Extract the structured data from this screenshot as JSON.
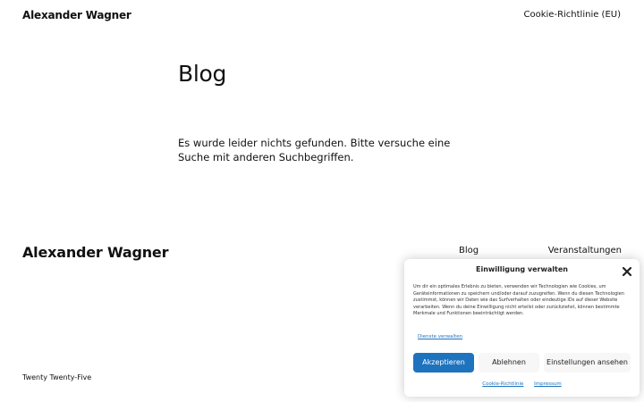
{
  "header": {
    "site_title": "Alexander Wagner",
    "cookie_link": "Cookie-Richtlinie (EU)"
  },
  "main": {
    "title": "Blog",
    "no_results": "Es wurde leider nichts gefunden. Bitte versuche eine Suche mit anderen Suchbegriffen."
  },
  "footer": {
    "site_title": "Alexander Wagner",
    "nav": [
      "Blog",
      "Veranstaltungen"
    ],
    "credit": "Twenty Twenty-Five"
  },
  "consent": {
    "title": "Einwilligung verwalten",
    "close_icon": "close-icon",
    "text": "Um dir ein optimales Erlebnis zu bieten, verwenden wir Technologien wie Cookies, um Geräteinformationen zu speichern und/oder darauf zuzugreifen. Wenn du diesen Technologien zustimmst, können wir Daten wie das Surfverhalten oder eindeutige IDs auf dieser Website verarbeiten. Wenn du deine Einwilligung nicht erteilst oder zurückziehst, können bestimmte Merkmale und Funktionen beeinträchtigt werden.",
    "services_link": "Dienste verwalten",
    "accept_label": "Akzeptieren",
    "deny_label": "Ablehnen",
    "settings_label": "Einstellungen ansehen",
    "footer_links": [
      "Cookie-Richtlinie",
      "Impressum"
    ],
    "accent_color": "#1e73be"
  }
}
